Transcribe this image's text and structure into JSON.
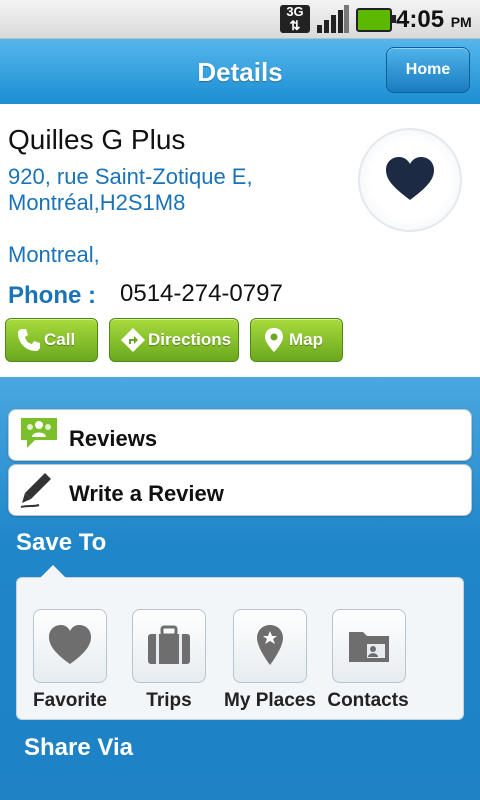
{
  "status_bar": {
    "network": "3G",
    "time": "4:05",
    "ampm": "PM"
  },
  "header": {
    "title": "Details",
    "home_label": "Home"
  },
  "place": {
    "name": "Quilles G Plus",
    "address_line1": "920, rue Saint-Zotique E,",
    "address_line2": "Montréal,H2S1M8",
    "city": "Montreal,",
    "phone_label": "Phone :",
    "phone": "0514-274-0797"
  },
  "actions": {
    "call": "Call",
    "directions": "Directions",
    "map": "Map"
  },
  "list": {
    "reviews": "Reviews",
    "write_review": "Write a Review"
  },
  "save_to": {
    "heading": "Save To",
    "items": [
      {
        "label": "Favorite",
        "icon": "heart-icon"
      },
      {
        "label": "Trips",
        "icon": "briefcase-icon"
      },
      {
        "label": "My Places",
        "icon": "map-pin-icon"
      },
      {
        "label": "Contacts",
        "icon": "contacts-folder-icon"
      }
    ]
  },
  "share_via": {
    "heading": "Share Via"
  },
  "colors": {
    "accent_blue": "#1f86c9",
    "link_blue": "#1a73b8",
    "button_green": "#6aa81e",
    "heart_navy": "#1c2a44"
  }
}
